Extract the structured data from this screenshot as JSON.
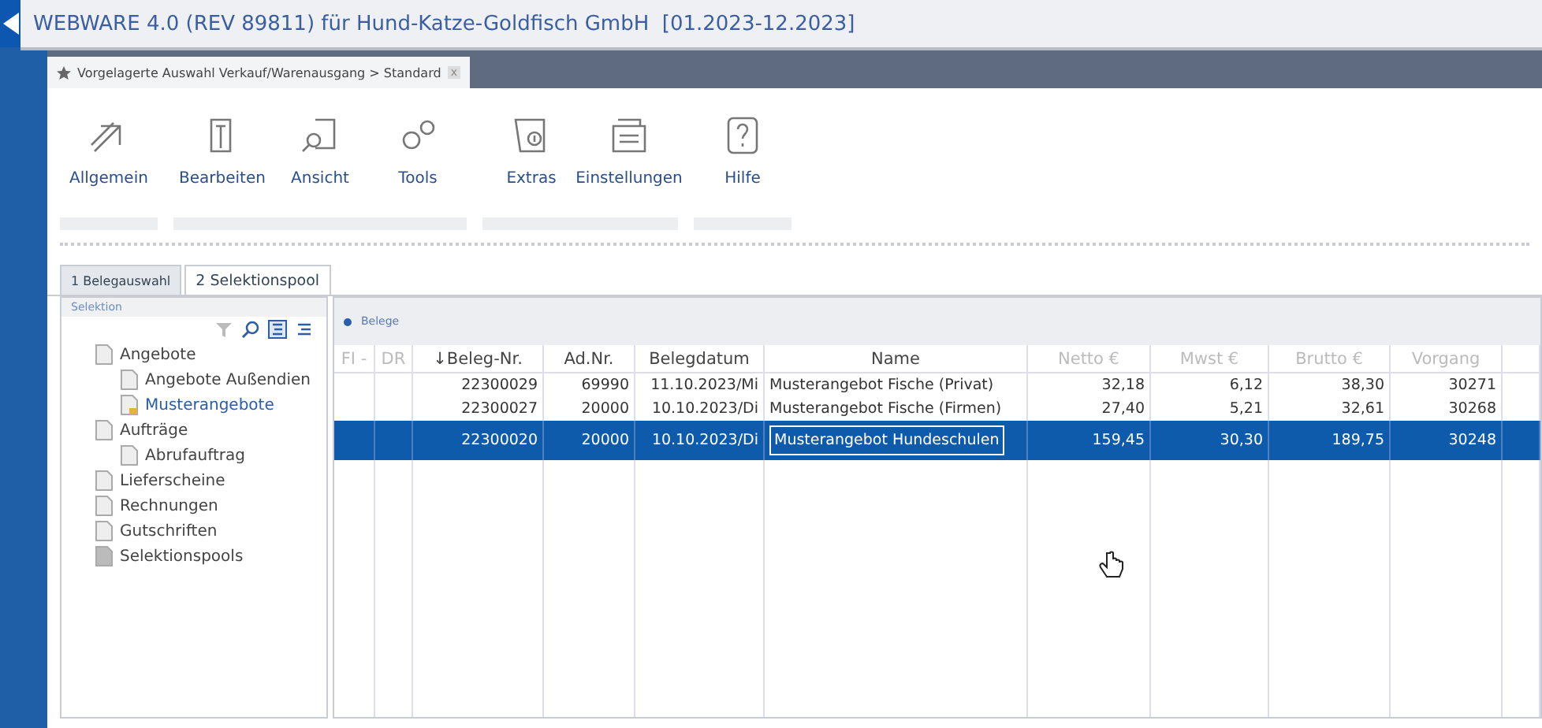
{
  "window": {
    "title": "WEBWARE 4.0 (REV 89811) für Hund-Katze-Goldfisch GmbH  [01.2023-12.2023]"
  },
  "document_tab": {
    "label": "Vorgelagerte Auswahl Verkauf/Warenausgang > Standard",
    "close": "x"
  },
  "toolbar": [
    [
      {
        "label": "Allgemein",
        "kind": "arrow"
      }
    ],
    [
      {
        "label": "Bearbeiten",
        "kind": "edit"
      },
      {
        "label": "Ansicht",
        "kind": "view"
      },
      {
        "label": "Tools",
        "kind": "gears"
      }
    ],
    [
      {
        "label": "Extras",
        "kind": "extras"
      },
      {
        "label": "Einstellungen",
        "kind": "settings"
      }
    ],
    [
      {
        "label": "Hilfe",
        "kind": "help"
      }
    ]
  ],
  "tabs": [
    {
      "label": "1 Belegauswahl",
      "selected": true
    },
    {
      "label": "2 Selektionspool",
      "selected": false
    }
  ],
  "sidebar": {
    "title": "Selektion",
    "items": [
      {
        "label": "Angebote",
        "selected": false,
        "children": [
          {
            "label": "Angebote Außendien",
            "selected": false
          },
          {
            "label": "Musterangebote",
            "selected": true
          }
        ]
      },
      {
        "label": "Aufträge",
        "selected": false,
        "children": [
          {
            "label": "Abrufauftrag",
            "selected": false
          }
        ]
      },
      {
        "label": "Lieferscheine",
        "selected": false
      },
      {
        "label": "Rechnungen",
        "selected": false
      },
      {
        "label": "Gutschriften",
        "selected": false
      },
      {
        "label": "Selektionspools",
        "selected": false
      }
    ]
  },
  "table": {
    "title": "Belege",
    "columns": [
      "FI -",
      "DR",
      "↓Beleg-Nr.",
      "Ad.Nr.",
      "Belegdatum",
      "Name",
      "Netto €",
      "Mwst €",
      "Brutto €",
      "Vorgang"
    ],
    "rows": [
      {
        "cells": [
          "",
          "",
          "22300029",
          "69990",
          "11.10.2023/Mi",
          "Musterangebot Fische (Privat)",
          "32,18",
          "6,12",
          "38,30",
          "30271"
        ],
        "selected": false
      },
      {
        "cells": [
          "",
          "",
          "22300027",
          "20000",
          "10.10.2023/Di",
          "Musterangebot Fische (Firmen)",
          "27,40",
          "5,21",
          "32,61",
          "30268"
        ],
        "selected": false
      },
      {
        "cells": [
          "",
          "",
          "22300020",
          "20000",
          "10.10.2023/Di",
          "Musterangebot Hundeschulen",
          "159,45",
          "30,30",
          "189,75",
          "30248"
        ],
        "selected": true
      }
    ]
  }
}
